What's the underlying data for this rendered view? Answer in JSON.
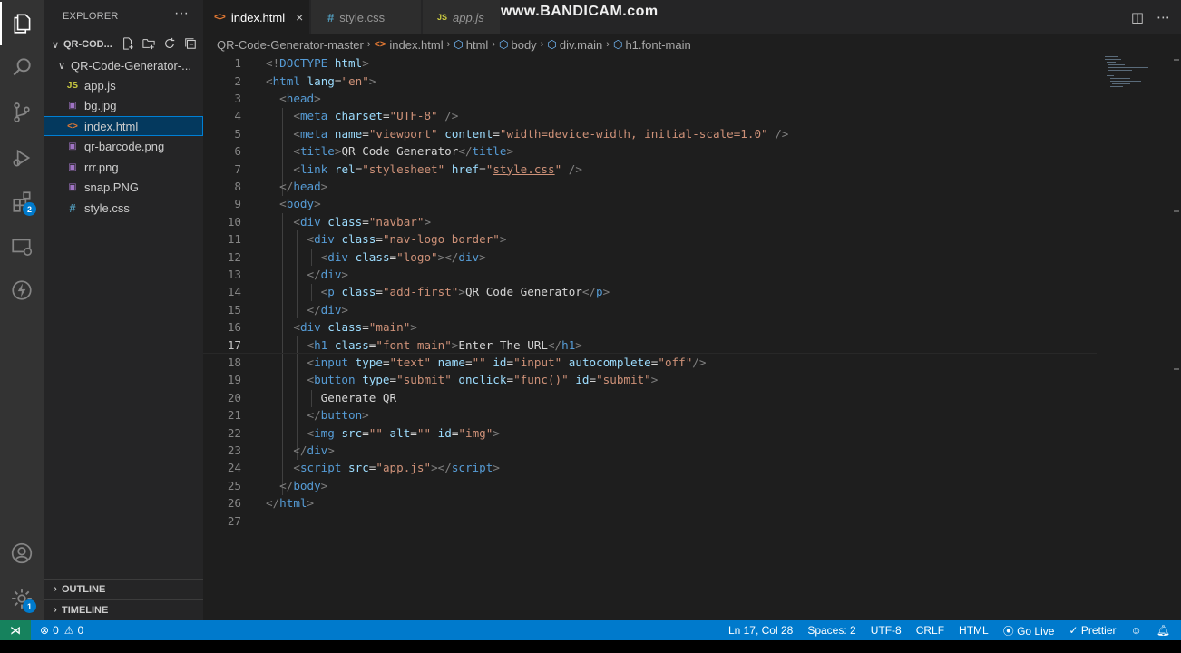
{
  "explorer": {
    "title": "EXPLORER",
    "more": "···",
    "root_folder": "QR-COD...",
    "subfolder": "QR-Code-Generator-...",
    "files": [
      {
        "name": "app.js",
        "icon": "JS"
      },
      {
        "name": "bg.jpg",
        "icon": "▣"
      },
      {
        "name": "index.html",
        "icon": "<>"
      },
      {
        "name": "qr-barcode.png",
        "icon": "▣"
      },
      {
        "name": "rrr.png",
        "icon": "▣"
      },
      {
        "name": "snap.PNG",
        "icon": "▣"
      },
      {
        "name": "style.css",
        "icon": "#"
      }
    ],
    "outline": "OUTLINE",
    "timeline": "TIMELINE"
  },
  "activity": {
    "extensions_badge": "2",
    "settings_badge": "1"
  },
  "tabs": [
    {
      "label": "index.html",
      "icon": "<>",
      "close": "×"
    },
    {
      "label": "style.css",
      "icon": "#"
    },
    {
      "label": "app.js",
      "icon": "JS"
    }
  ],
  "watermark": "www.BANDICAM.com",
  "breadcrumb": {
    "folder": "QR-Code-Generator-master",
    "file": "index.html",
    "items": [
      "html",
      "body",
      "div.main",
      "h1.font-main"
    ]
  },
  "code": {
    "line_numbers": [
      "1",
      "2",
      "3",
      "4",
      "5",
      "6",
      "7",
      "8",
      "9",
      "10",
      "11",
      "12",
      "13",
      "14",
      "15",
      "16",
      "17",
      "18",
      "19",
      "20",
      "21",
      "22",
      "23",
      "24",
      "25",
      "26",
      "27"
    ],
    "current_line": "17"
  },
  "status": {
    "errors": "0",
    "warnings": "0",
    "position": "Ln 17, Col 28",
    "spaces": "Spaces: 2",
    "encoding": "UTF-8",
    "eol": "CRLF",
    "language": "HTML",
    "golive": "Go Live",
    "prettier": "Prettier"
  },
  "colors": {
    "accent": "#007acc",
    "remote": "#16825d",
    "tag": "#569cd6",
    "attr": "#9cdcfe",
    "string": "#ce9178"
  }
}
